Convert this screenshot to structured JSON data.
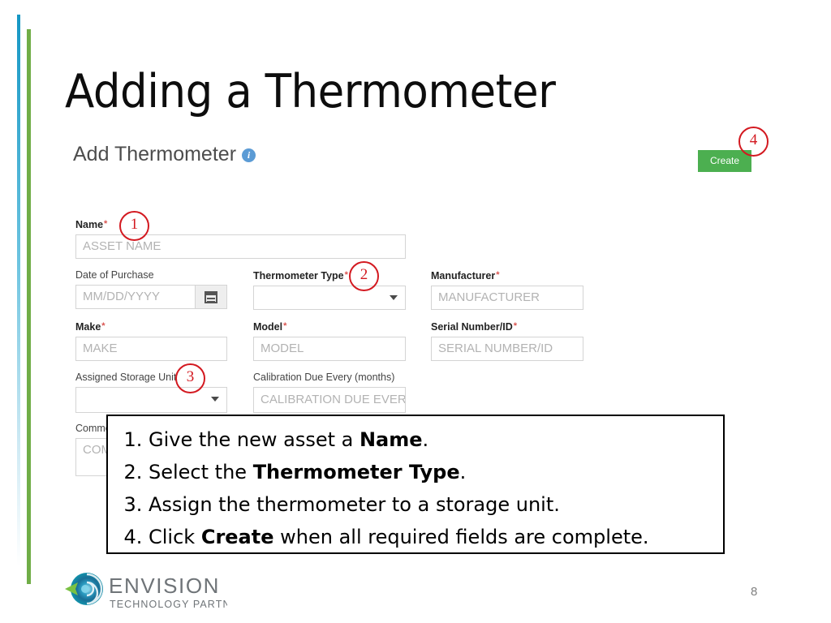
{
  "slide": {
    "title": "Adding a Thermometer",
    "page_number": "8",
    "accent_blue": "#1597c4",
    "accent_green": "#70ad47"
  },
  "app": {
    "heading": "Add Thermometer",
    "info_icon": "info-icon",
    "create_button": {
      "label": "Create",
      "color": "#4caf50"
    },
    "required_marker": "*",
    "form": {
      "name": {
        "label": "Name",
        "required": true,
        "placeholder": "ASSET NAME"
      },
      "date_of_purchase": {
        "label": "Date of Purchase",
        "required": false,
        "placeholder": "MM/DD/YYYY",
        "button_icon": "calendar-icon"
      },
      "thermometer_type": {
        "label": "Thermometer Type",
        "required": true,
        "value": "",
        "icon": "chevron-down-icon"
      },
      "manufacturer": {
        "label": "Manufacturer",
        "required": true,
        "placeholder": "MANUFACTURER"
      },
      "make": {
        "label": "Make",
        "required": true,
        "placeholder": "MAKE"
      },
      "model": {
        "label": "Model",
        "required": true,
        "placeholder": "MODEL"
      },
      "serial_number": {
        "label": "Serial Number/ID",
        "required": true,
        "placeholder": "SERIAL NUMBER/ID"
      },
      "assigned_storage_unit": {
        "label": "Assigned Storage Unit",
        "required": false,
        "value": "",
        "icon": "chevron-down-icon"
      },
      "calibration_due": {
        "label": "Calibration Due Every (months)",
        "required": false,
        "placeholder": "CALIBRATION DUE EVERY"
      },
      "comments": {
        "label": "Comments",
        "required": false,
        "placeholder": "COMMENTS"
      }
    }
  },
  "callouts": [
    {
      "number": "1"
    },
    {
      "number": "2"
    },
    {
      "number": "3"
    },
    {
      "number": "4"
    }
  ],
  "instructions": [
    {
      "pre": "Give the new asset a ",
      "bold": "Name",
      "post": "."
    },
    {
      "pre": "Select the ",
      "bold": "Thermometer Type",
      "post": "."
    },
    {
      "pre": "Assign the thermometer to a storage unit.",
      "bold": "",
      "post": ""
    },
    {
      "pre": "Click ",
      "bold": "Create",
      "post": " when all required fields are complete."
    }
  ],
  "logo": {
    "name": "ENVISION",
    "tagline": "TECHNOLOGY PARTNERS"
  }
}
